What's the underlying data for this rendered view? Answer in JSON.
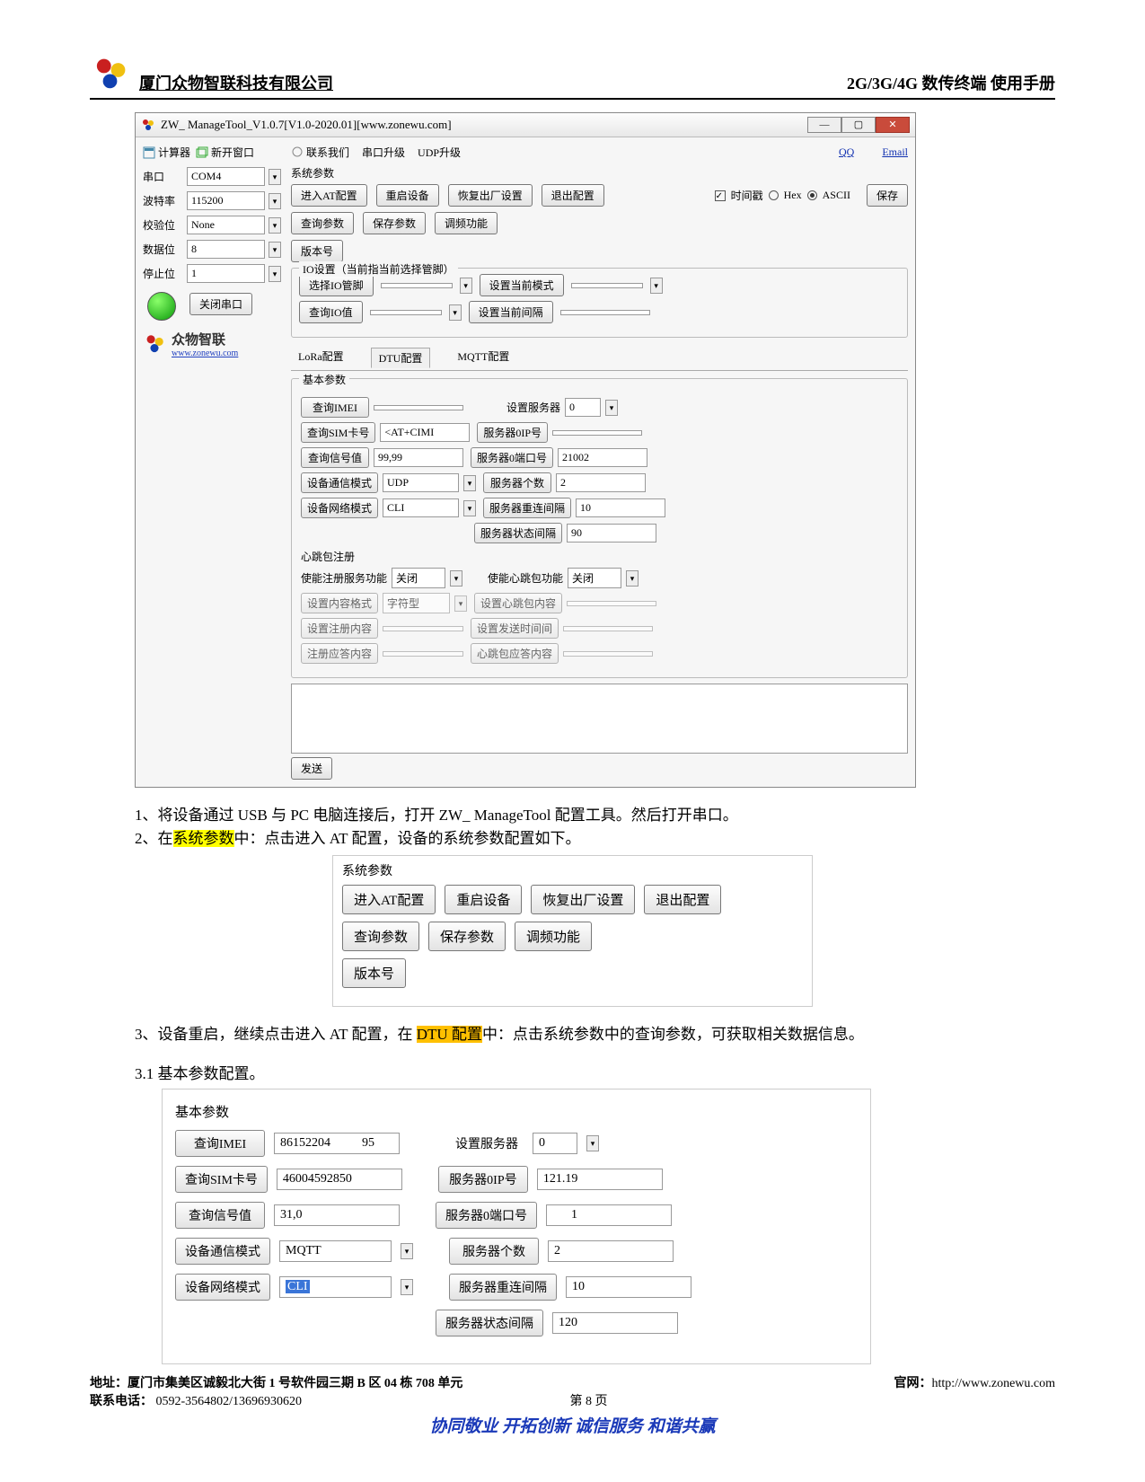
{
  "header": {
    "company": "厦门众物智联科技有限公司",
    "manual": "2G/3G/4G 数传终端 使用手册"
  },
  "app": {
    "title": "ZW_ ManageTool_V1.0.7[V1.0-2020.01][www.zonewu.com]",
    "toolbar": {
      "calc": "计算器",
      "newwin": "新开窗口",
      "contact": "联系我们",
      "serialup": "串口升级",
      "udpup": "UDP升级",
      "qq": "QQ",
      "email": "Email"
    },
    "port": {
      "lbl_port": "串口",
      "port": "COM4",
      "lbl_baud": "波特率",
      "baud": "115200",
      "lbl_parity": "校验位",
      "parity": "None",
      "lbl_data": "数据位",
      "data": "8",
      "lbl_stop": "停止位",
      "stop": "1",
      "close": "关闭串口",
      "brand": "众物智联",
      "brand_url": "www.zonewu.com"
    },
    "sys": {
      "hdr": "系统参数",
      "enter_at": "进入AT配置",
      "reboot": "重启设备",
      "restore": "恢复出厂设置",
      "exit": "退出配置",
      "query": "查询参数",
      "save": "保存参数",
      "freq": "调频功能",
      "ver": "版本号",
      "time_chk": "时间戳",
      "hex": "Hex",
      "ascii": "ASCII",
      "save_btn": "保存"
    },
    "io": {
      "title": "IO设置（当前指当前选择管脚）",
      "select_io": "选择IO管脚",
      "set_mode": "设置当前模式",
      "query_io": "查询IO值",
      "set_gap": "设置当前间隔"
    },
    "tabs": {
      "lora": "LoRa配置",
      "dtu": "DTU配置",
      "mqtt": "MQTT配置"
    },
    "basic": {
      "title": "基本参数",
      "imei": "查询IMEI",
      "imei_v": "",
      "sim": "查询SIM卡号",
      "sim_v": "<AT+CIMI",
      "sig": "查询信号值",
      "sig_v": "99,99",
      "comm": "设备通信模式",
      "comm_v": "UDP",
      "net": "设备网络模式",
      "net_v": "CLI",
      "set_srv": "设置服务器",
      "set_srv_v": "0",
      "srv_ip": "服务器0IP号",
      "srv_ip_v": "",
      "srv_port": "服务器0端口号",
      "srv_port_v": "21002",
      "srv_cnt": "服务器个数",
      "srv_cnt_v": "2",
      "srv_recon": "服务器重连间隔",
      "srv_recon_v": "10",
      "srv_stat": "服务器状态间隔",
      "srv_stat_v": "90"
    },
    "heart": {
      "title": "心跳包注册",
      "en_reg": "使能注册服务功能",
      "en_reg_v": "关闭",
      "en_hb": "使能心跳包功能",
      "en_hb_v": "关闭",
      "fmt": "设置内容格式",
      "fmt_v": "字符型",
      "hb_content": "设置心跳包内容",
      "reg_content": "设置注册内容",
      "send_time": "设置发送时间间",
      "reply": "注册应答内容",
      "hb_reply": "心跳包应答内容"
    },
    "send_btn": "发送"
  },
  "instr": {
    "s1a": "1、将设备通过 USB 与 PC 电脑连接后，打开 ZW_ ManageTool 配置工具。然后打开串口。",
    "s2a": "2、在",
    "s2b": "系统参数",
    "s2c": "中：点击进入 AT 配置，设备的系统参数配置如下。",
    "s3a": "3、设备重启，继续点击进入 AT 配置，在 ",
    "s3b": "DTU 配置",
    "s3c": "中：点击系统参数中的查询参数，可获取相关数据信息。",
    "s31": "3.1 基本参数配置。"
  },
  "panel2": {
    "hdr": "系统参数",
    "enter_at": "进入AT配置",
    "reboot": "重启设备",
    "restore": "恢复出厂设置",
    "exit": "退出配置",
    "query": "查询参数",
    "save": "保存参数",
    "freq": "调频功能",
    "ver": "版本号"
  },
  "panel3": {
    "hdr": "基本参数",
    "imei": "查询IMEI",
    "imei_v": "86152204     95",
    "sim": "查询SIM卡号",
    "sim_v": "46004592850 ",
    "sig": "查询信号值",
    "sig_v": "31,0",
    "comm": "设备通信模式",
    "comm_v": "MQTT",
    "net": "设备网络模式",
    "net_v": "CLI",
    "set_srv": "设置服务器",
    "set_srv_v": "0",
    "srv_ip": "服务器0IP号",
    "srv_ip_v": "121.19 ",
    "srv_port": "服务器0端口号",
    "srv_port_v": "   1",
    "srv_cnt": "服务器个数",
    "srv_cnt_v": "2",
    "srv_recon": "服务器重连间隔",
    "srv_recon_v": "10",
    "srv_stat": "服务器状态间隔",
    "srv_stat_v": "120"
  },
  "footer": {
    "addr_lbl": "地址：",
    "addr": "厦门市集美区诚毅北大街 1 号软件园三期 B 区 04 栋 708 单元",
    "site_lbl": "官网：",
    "site": "http://www.zonewu.com",
    "tel_lbl": "联系电话：",
    "tel": " 0592-3564802/13696930620",
    "page": "第 8 页",
    "slogan": "协同敬业 开拓创新 诚信服务 和谐共赢"
  }
}
